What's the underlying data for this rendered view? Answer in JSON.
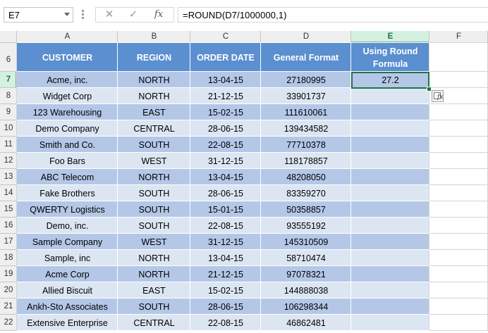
{
  "formula_bar": {
    "name_box": "E7",
    "cancel_symbol": "✕",
    "enter_symbol": "✓",
    "fx_label": "fx",
    "formula": "=ROUND(D7/1000000,1)"
  },
  "sheet": {
    "column_headers": [
      "A",
      "B",
      "C",
      "D",
      "E",
      "F"
    ],
    "selected_column": "E",
    "selected_row": "7",
    "row_numbers": [
      "6",
      "7",
      "8",
      "9",
      "10",
      "11",
      "12",
      "13",
      "14",
      "15",
      "16",
      "17",
      "18",
      "19",
      "20",
      "21",
      "22"
    ],
    "table_headers": [
      "CUSTOMER",
      "REGION",
      "ORDER DATE",
      "General Format",
      "Using Round Formula"
    ],
    "rows": [
      {
        "customer": "Acme, inc.",
        "region": "NORTH",
        "date": "13-04-15",
        "general": "27180995",
        "rounded": "27.2"
      },
      {
        "customer": "Widget Corp",
        "region": "NORTH",
        "date": "21-12-15",
        "general": "33901737",
        "rounded": ""
      },
      {
        "customer": "123 Warehousing",
        "region": "EAST",
        "date": "15-02-15",
        "general": "111610061",
        "rounded": ""
      },
      {
        "customer": "Demo Company",
        "region": "CENTRAL",
        "date": "28-06-15",
        "general": "139434582",
        "rounded": ""
      },
      {
        "customer": "Smith and Co.",
        "region": "SOUTH",
        "date": "22-08-15",
        "general": "77710378",
        "rounded": ""
      },
      {
        "customer": "Foo Bars",
        "region": "WEST",
        "date": "31-12-15",
        "general": "118178857",
        "rounded": ""
      },
      {
        "customer": "ABC Telecom",
        "region": "NORTH",
        "date": "13-04-15",
        "general": "48208050",
        "rounded": ""
      },
      {
        "customer": "Fake Brothers",
        "region": "SOUTH",
        "date": "28-06-15",
        "general": "83359270",
        "rounded": ""
      },
      {
        "customer": "QWERTY Logistics",
        "region": "SOUTH",
        "date": "15-01-15",
        "general": "50358857",
        "rounded": ""
      },
      {
        "customer": "Demo, inc.",
        "region": "SOUTH",
        "date": "22-08-15",
        "general": "93555192",
        "rounded": ""
      },
      {
        "customer": "Sample Company",
        "region": "WEST",
        "date": "31-12-15",
        "general": "145310509",
        "rounded": ""
      },
      {
        "customer": "Sample, inc",
        "region": "NORTH",
        "date": "13-04-15",
        "general": "58710474",
        "rounded": ""
      },
      {
        "customer": "Acme Corp",
        "region": "NORTH",
        "date": "21-12-15",
        "general": "97078321",
        "rounded": ""
      },
      {
        "customer": "Allied Biscuit",
        "region": "EAST",
        "date": "15-02-15",
        "general": "144888038",
        "rounded": ""
      },
      {
        "customer": "Ankh-Sto Associates",
        "region": "SOUTH",
        "date": "28-06-15",
        "general": "106298344",
        "rounded": ""
      },
      {
        "customer": "Extensive Enterprise",
        "region": "CENTRAL",
        "date": "22-08-15",
        "general": "46862481",
        "rounded": ""
      }
    ]
  },
  "colors": {
    "header_fill": "#5b8fcf",
    "band_dark": "#b4c7e7",
    "band_light": "#dce6f2",
    "active_border": "#217346",
    "selected_header": "#d3f0e0"
  },
  "icons": [
    "name-box-dropdown-icon",
    "cancel-icon",
    "enter-icon",
    "fx-icon",
    "quick-analysis-icon"
  ]
}
